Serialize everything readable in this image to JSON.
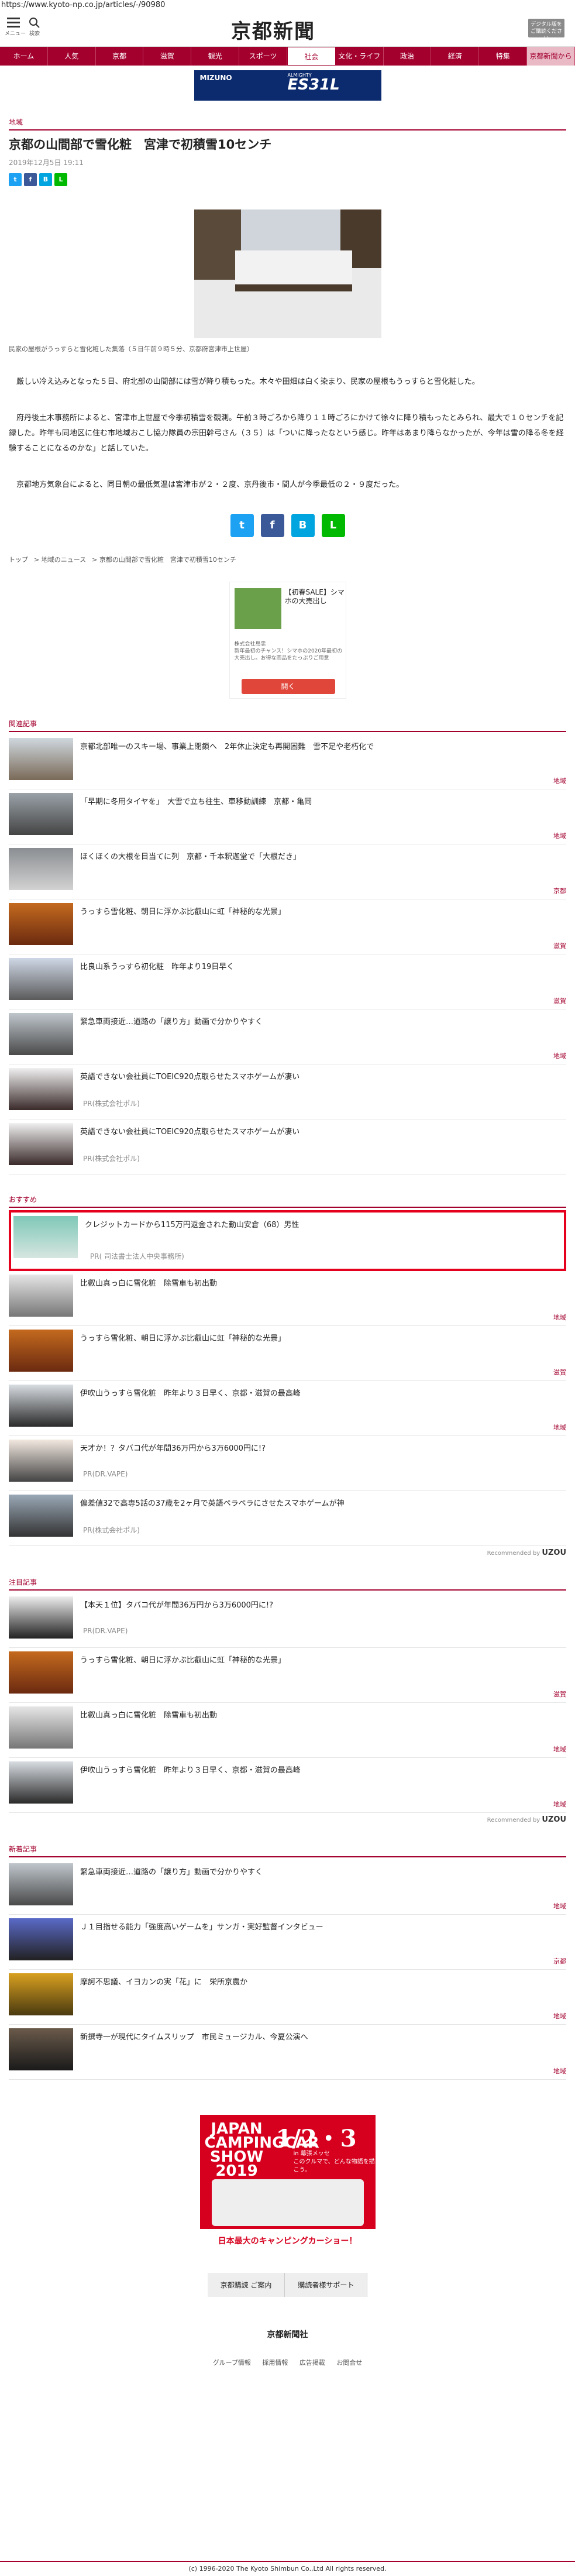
{
  "url": "https://www.kyoto-np.co.jp/articles/-/90980",
  "header": {
    "menu_label": "メニュー",
    "search_label": "検索",
    "logo": "京都新聞",
    "digital_btn": "デジタル版をご購読ください"
  },
  "nav": [
    "ホーム",
    "人気",
    "京都",
    "滋賀",
    "観光",
    "スポーツ",
    "社会",
    "文化・ライフ",
    "政治",
    "経済",
    "特集",
    "京都新聞から"
  ],
  "top_ad": {
    "brand": "MIZUNO",
    "sub": "ALMIGHTY",
    "model": "ES31L"
  },
  "article": {
    "category": "地域",
    "title": "京都の山間部で雪化粧　宮津で初積雪10センチ",
    "date": "2019年12月5日 19:11",
    "caption": "民家の屋根がうっすらと雪化粧した集落（５日午前９時５分、京都府宮津市上世屋）",
    "paragraphs": [
      "　厳しい冷え込みとなった５日、府北部の山間部には雪が降り積もった。木々や田畑は白く染まり、民家の屋根もうっすらと雪化粧した。",
      "　府丹後土木事務所によると、宮津市上世屋で今季初積雪を観測。午前３時ごろから降り１１時ごろにかけて徐々に降り積もったとみられ、最大で１０センチを記録した。昨年も同地区に住む市地域おこし協力隊員の宗田幹弓さん（３５）は「ついに降ったなという感じ。昨年はあまり降らなかったが、今年は雪の降る冬を経験することになるのかな」と話していた。",
      "　京都地方気象台によると、同日朝の最低気温は宮津市が２・２度、京丹後市・間人が今季最低の２・９度だった。"
    ],
    "breadcrumb": [
      "トップ",
      "地域のニュース",
      "京都の山間部で雪化粧　宮津で初積雪10センチ"
    ]
  },
  "mid_ad": {
    "title": "【初春SALE】シマホの大売出し",
    "company": "株式会社島忠",
    "desc": "新年最初のチャンス！シマホの2020年最初の大売出し。お得な商品をたっぷりご用意",
    "button": "開く"
  },
  "related": {
    "title": "関連記事",
    "items": [
      {
        "text": "京都北部唯一のスキー場、事業上閉鎖へ　2年休止決定も再開困難　雪不足や老朽化で",
        "tag": "地域"
      },
      {
        "text": "「早期に冬用タイヤを」　大雪で立ち往生、車移動訓練　京都・亀岡",
        "tag": "地域"
      },
      {
        "text": "ほくほくの大根を目当てに列　京都・千本釈迦堂で「大根だき」",
        "tag": "京都"
      },
      {
        "text": "うっすら雪化粧、朝日に浮かぶ比叡山に虹「神秘的な光景」",
        "tag": "滋賀"
      },
      {
        "text": "比良山系うっすら初化粧　昨年より19日早く",
        "tag": "滋賀"
      },
      {
        "text": "緊急車両接近…道路の「譲り方」動画で分かりやすく",
        "tag": "地域"
      },
      {
        "text": "英語できない会社員にTOEIC920点取らせたスマホゲームが凄い",
        "pr": "PR(株式会社ポル)"
      },
      {
        "text": "英語できない会社員にTOEIC920点取らせたスマホゲームが凄い",
        "pr": "PR(株式会社ポル)"
      }
    ]
  },
  "recommend": {
    "title": "おすすめ",
    "items": [
      {
        "text": "クレジットカードから115万円返金された勤山安倉（68）男性",
        "pr": "PR( 司法書士法人中央事務所)"
      },
      {
        "text": "比叡山真っ白に雪化粧　除雪車も初出動",
        "tag": "地域"
      },
      {
        "text": "うっすら雪化粧、朝日に浮かぶ比叡山に虹「神秘的な光景」",
        "tag": "滋賀"
      },
      {
        "text": "伊吹山うっすら雪化粧　昨年より３日早く、京都・滋賀の最高峰",
        "tag": "地域"
      },
      {
        "text": "天才か！？タバコ代が年間36万円から3万6000円に!?",
        "pr": "PR(DR.VAPE)"
      },
      {
        "text": "偏差値32で高専5話の37歳を2ヶ月で英語ペラペラにさせたスマホゲームが神",
        "pr": "PR(株式会社ポル)"
      }
    ],
    "recommended_by": "Recommended by",
    "provider": "UZOU"
  },
  "popular": {
    "title": "注目記事",
    "items": [
      {
        "text": "【本天１位】タバコ代が年間36万円から3万6000円に!?",
        "pr": "PR(DR.VAPE)"
      },
      {
        "text": "うっすら雪化粧、朝日に浮かぶ比叡山に虹「神秘的な光景」",
        "tag": "滋賀"
      },
      {
        "text": "比叡山真っ白に雪化粧　除雪車も初出動",
        "tag": "地域"
      },
      {
        "text": "伊吹山うっすら雪化粧　昨年より３日早く、京都・滋賀の最高峰",
        "tag": "地域"
      }
    ],
    "recommended_by": "Recommended by",
    "provider": "UZOU"
  },
  "latest": {
    "title": "新着記事",
    "items": [
      {
        "text": "緊急車両接近…道路の「譲り方」動画で分かりやすく",
        "tag": "地域"
      },
      {
        "text": "Ｊ１目指せる能力「強度高いゲームを」サンガ・実好監督インタビュー",
        "tag": "京都"
      },
      {
        "text": "摩訶不思議、イヨカンの実「花」に　栄所京農か",
        "tag": "地域"
      },
      {
        "text": "新撰寺一が現代にタイムスリップ　市民ミュージカル、今夏公演へ",
        "tag": "地域"
      }
    ]
  },
  "bottom_ad": {
    "left": "JAPAN CAMPINGCAR SHOW 2019",
    "date": "1/2・3",
    "venue": "in 幕張メッセ",
    "copy": "このクルマで、どんな物語を描こう。",
    "foot": "日本最大のキャンピングカーショー！"
  },
  "footer": {
    "buttons": [
      "京都購読 ご案内",
      "購読者様サポート"
    ],
    "logo": "京都新聞社",
    "links": [
      "グループ情報",
      "採用情報",
      "広告掲載",
      "お問合せ"
    ],
    "copyright": "(c) 1996-2020 The Kyoto Shimbun Co.,Ltd All rights reserved."
  }
}
